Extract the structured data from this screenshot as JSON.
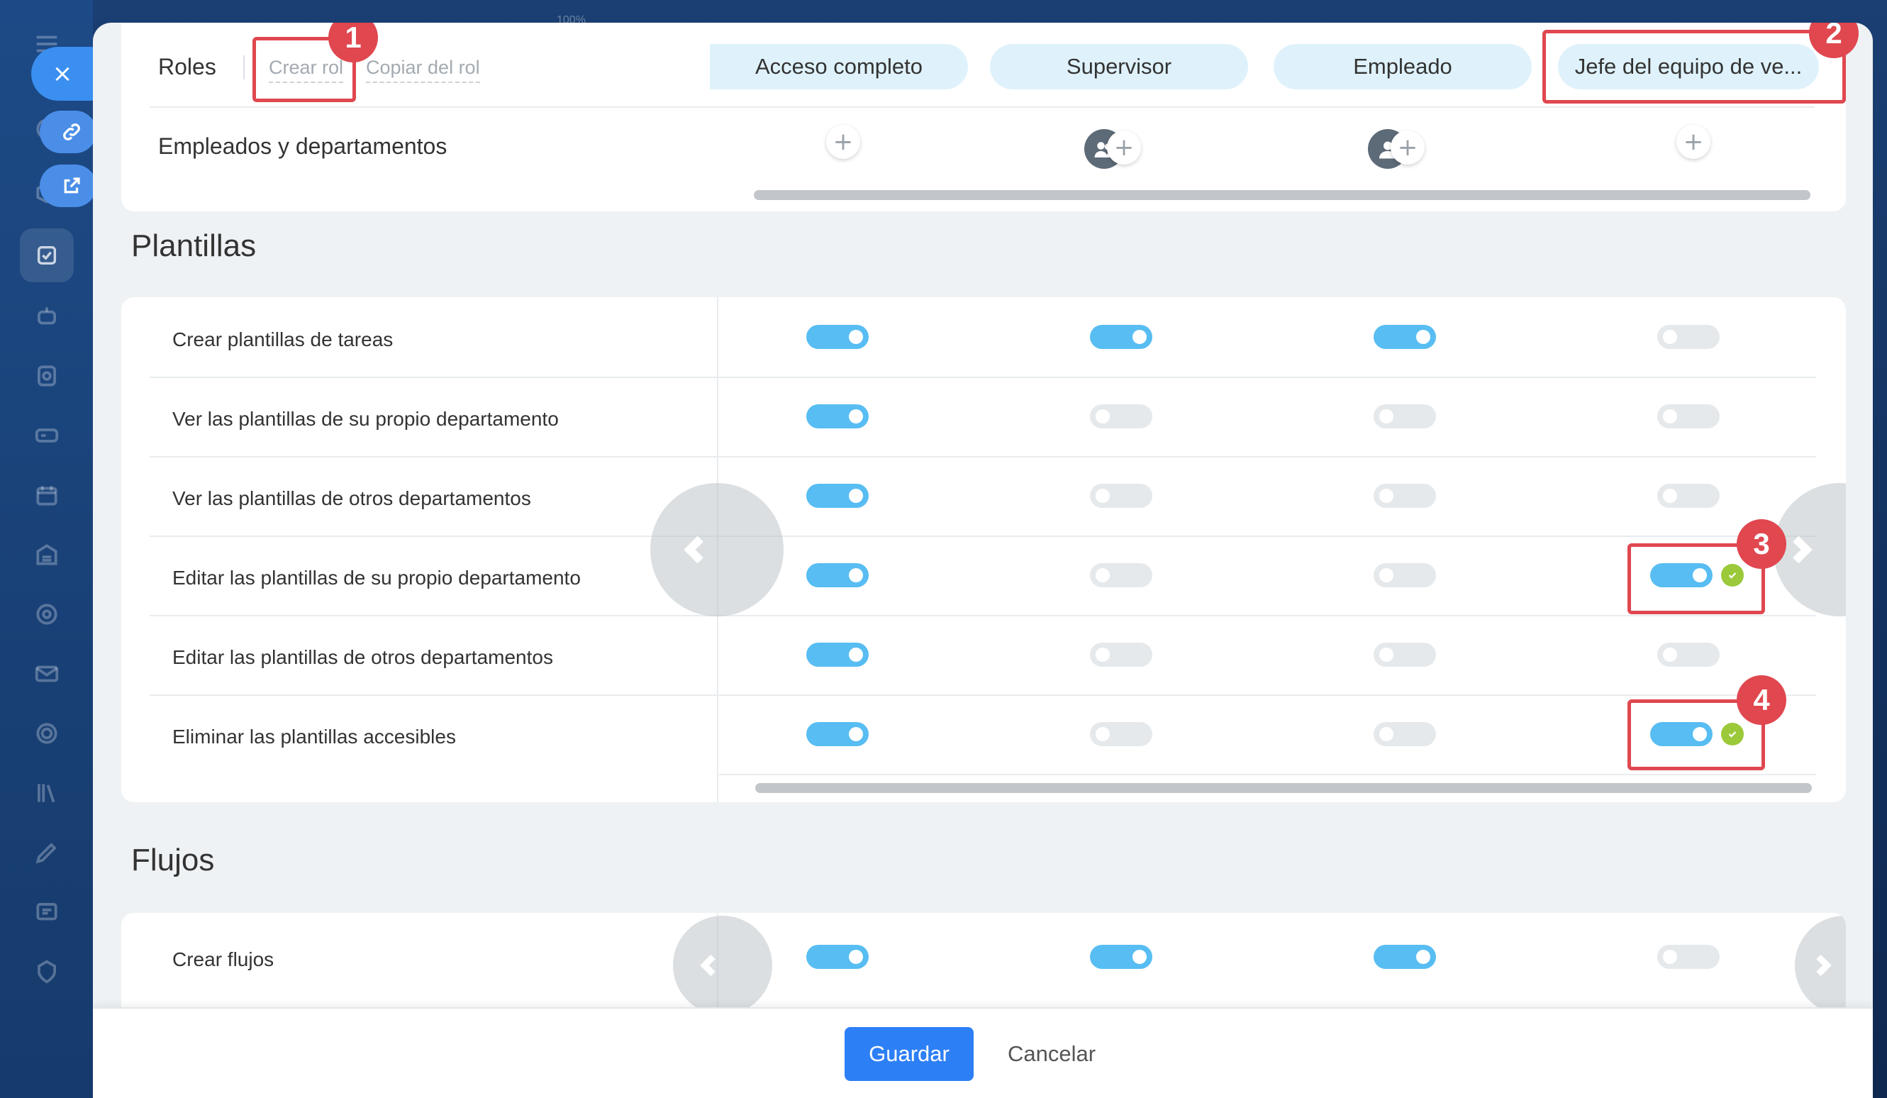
{
  "background_fragment": "100%",
  "sidebar": {
    "close_icon": "×",
    "icons": [
      "menu-icon",
      "link-icon",
      "external-link-icon",
      "tasks-icon",
      "robot-icon",
      "sites-icon",
      "drive-icon",
      "calendar-icon",
      "store-icon",
      "target-icon",
      "mail-icon",
      "settings-icon",
      "library-icon",
      "sign-icon",
      "chat-icon",
      "shield-icon"
    ]
  },
  "roles_header": {
    "label": "Roles",
    "create_role": "Crear rol",
    "copy_role": "Copiar del rol",
    "roles": [
      "Acceso completo",
      "Supervisor",
      "Empleado",
      "Jefe del equipo de ve..."
    ],
    "employees_label": "Empleados y departamentos"
  },
  "plantillas": {
    "title": "Plantillas",
    "rows": [
      {
        "label": "Crear plantillas de tareas",
        "values": [
          true,
          true,
          true,
          false
        ]
      },
      {
        "label": "Ver las plantillas de su propio departamento",
        "values": [
          true,
          false,
          false,
          false
        ]
      },
      {
        "label": "Ver las plantillas de otros departamentos",
        "values": [
          true,
          false,
          false,
          false
        ]
      },
      {
        "label": "Editar las plantillas de su propio departamento",
        "values": [
          true,
          false,
          false,
          true
        ]
      },
      {
        "label": "Editar las plantillas de otros departamentos",
        "values": [
          true,
          false,
          false,
          false
        ]
      },
      {
        "label": "Eliminar las plantillas accesibles",
        "values": [
          true,
          false,
          false,
          true
        ]
      }
    ]
  },
  "flujos": {
    "title": "Flujos",
    "rows": [
      {
        "label": "Crear flujos",
        "values": [
          true,
          true,
          true,
          false
        ]
      }
    ]
  },
  "annotations": {
    "b1": "1",
    "b2": "2",
    "b3": "3",
    "b4": "4",
    "color": "#e0474f"
  },
  "colors": {
    "toggle_on": "#57bdf2",
    "toggle_off": "#e6e9eb",
    "accent": "#2d7ff6",
    "check": "#9bc93a"
  },
  "footer": {
    "save": "Guardar",
    "cancel": "Cancelar"
  }
}
